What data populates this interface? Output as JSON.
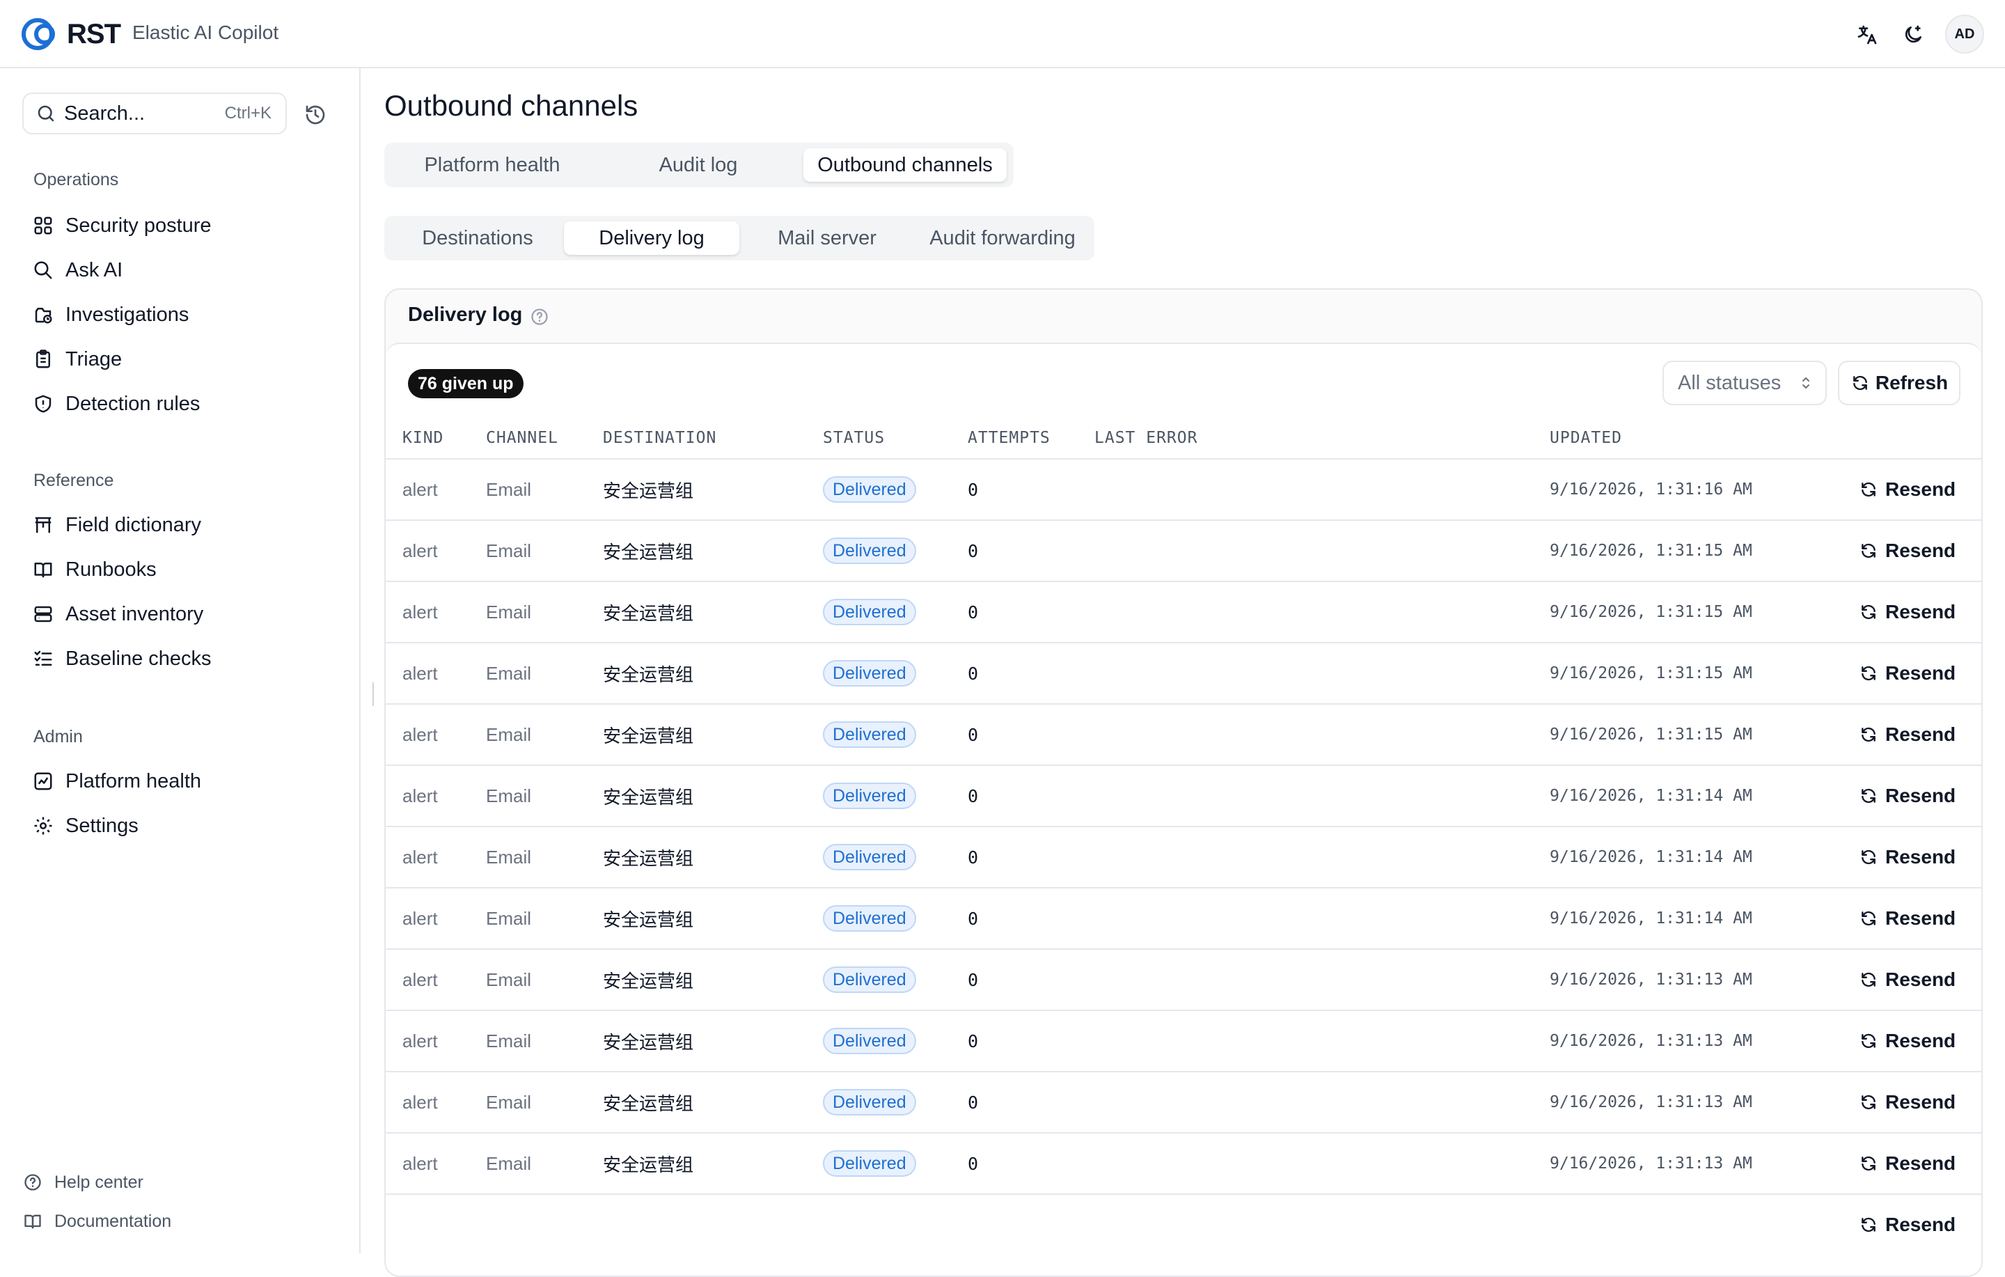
{
  "header": {
    "logo_text": "RST",
    "app_name": "Elastic AI Copilot",
    "avatar_initials": "AD",
    "icons": [
      "translate-icon",
      "theme-moon-icon"
    ]
  },
  "sidebar": {
    "search_placeholder": "Search...",
    "search_shortcut": "Ctrl+K",
    "sections": [
      {
        "label": "Operations",
        "items": [
          {
            "label": "Security posture",
            "icon": "grid-icon"
          },
          {
            "label": "Ask AI",
            "icon": "search-icon"
          },
          {
            "label": "Investigations",
            "icon": "case-icon"
          },
          {
            "label": "Triage",
            "icon": "clipboard-icon"
          },
          {
            "label": "Detection rules",
            "icon": "shield-icon"
          }
        ]
      },
      {
        "label": "Reference",
        "items": [
          {
            "label": "Field dictionary",
            "icon": "table-icon"
          },
          {
            "label": "Runbooks",
            "icon": "book-open-icon"
          },
          {
            "label": "Asset inventory",
            "icon": "server-icon"
          },
          {
            "label": "Baseline checks",
            "icon": "checklist-icon"
          }
        ]
      },
      {
        "label": "Admin",
        "items": [
          {
            "label": "Platform health",
            "icon": "chart-icon"
          },
          {
            "label": "Settings",
            "icon": "gear-icon"
          }
        ]
      }
    ],
    "footer": [
      {
        "label": "Help center",
        "icon": "help-icon"
      },
      {
        "label": "Documentation",
        "icon": "book-icon"
      }
    ]
  },
  "main": {
    "title": "Outbound channels",
    "tabs": [
      {
        "label": "Platform health",
        "active": false
      },
      {
        "label": "Audit log",
        "active": false
      },
      {
        "label": "Outbound channels",
        "active": true
      }
    ],
    "subtabs": [
      {
        "label": "Destinations",
        "active": false
      },
      {
        "label": "Delivery log",
        "active": true
      },
      {
        "label": "Mail server",
        "active": false
      },
      {
        "label": "Audit forwarding",
        "active": false
      }
    ]
  },
  "panel": {
    "title": "Delivery log",
    "given_up_badge": "76 given up",
    "status_filter": "All statuses",
    "refresh_label": "Refresh",
    "resend_label": "Resend",
    "columns": [
      "KIND",
      "CHANNEL",
      "DESTINATION",
      "STATUS",
      "ATTEMPTS",
      "LAST ERROR",
      "UPDATED"
    ],
    "rows": [
      {
        "kind": "alert",
        "channel": "Email",
        "destination": "安全运营组",
        "status": "Delivered",
        "attempts": "0",
        "last_error": "",
        "updated": "9/16/2026, 1:31:16 AM"
      },
      {
        "kind": "alert",
        "channel": "Email",
        "destination": "安全运营组",
        "status": "Delivered",
        "attempts": "0",
        "last_error": "",
        "updated": "9/16/2026, 1:31:15 AM"
      },
      {
        "kind": "alert",
        "channel": "Email",
        "destination": "安全运营组",
        "status": "Delivered",
        "attempts": "0",
        "last_error": "",
        "updated": "9/16/2026, 1:31:15 AM"
      },
      {
        "kind": "alert",
        "channel": "Email",
        "destination": "安全运营组",
        "status": "Delivered",
        "attempts": "0",
        "last_error": "",
        "updated": "9/16/2026, 1:31:15 AM"
      },
      {
        "kind": "alert",
        "channel": "Email",
        "destination": "安全运营组",
        "status": "Delivered",
        "attempts": "0",
        "last_error": "",
        "updated": "9/16/2026, 1:31:15 AM"
      },
      {
        "kind": "alert",
        "channel": "Email",
        "destination": "安全运营组",
        "status": "Delivered",
        "attempts": "0",
        "last_error": "",
        "updated": "9/16/2026, 1:31:14 AM"
      },
      {
        "kind": "alert",
        "channel": "Email",
        "destination": "安全运营组",
        "status": "Delivered",
        "attempts": "0",
        "last_error": "",
        "updated": "9/16/2026, 1:31:14 AM"
      },
      {
        "kind": "alert",
        "channel": "Email",
        "destination": "安全运营组",
        "status": "Delivered",
        "attempts": "0",
        "last_error": "",
        "updated": "9/16/2026, 1:31:14 AM"
      },
      {
        "kind": "alert",
        "channel": "Email",
        "destination": "安全运营组",
        "status": "Delivered",
        "attempts": "0",
        "last_error": "",
        "updated": "9/16/2026, 1:31:13 AM"
      },
      {
        "kind": "alert",
        "channel": "Email",
        "destination": "安全运营组",
        "status": "Delivered",
        "attempts": "0",
        "last_error": "",
        "updated": "9/16/2026, 1:31:13 AM"
      },
      {
        "kind": "alert",
        "channel": "Email",
        "destination": "安全运营组",
        "status": "Delivered",
        "attempts": "0",
        "last_error": "",
        "updated": "9/16/2026, 1:31:13 AM"
      },
      {
        "kind": "alert",
        "channel": "Email",
        "destination": "安全运营组",
        "status": "Delivered",
        "attempts": "0",
        "last_error": "",
        "updated": "9/16/2026, 1:31:13 AM"
      }
    ],
    "colors": {
      "status_delivered_text": "#1f6fd1",
      "status_delivered_bg": "#e8f1fd",
      "brand_blue": "#1d6fd6"
    }
  }
}
